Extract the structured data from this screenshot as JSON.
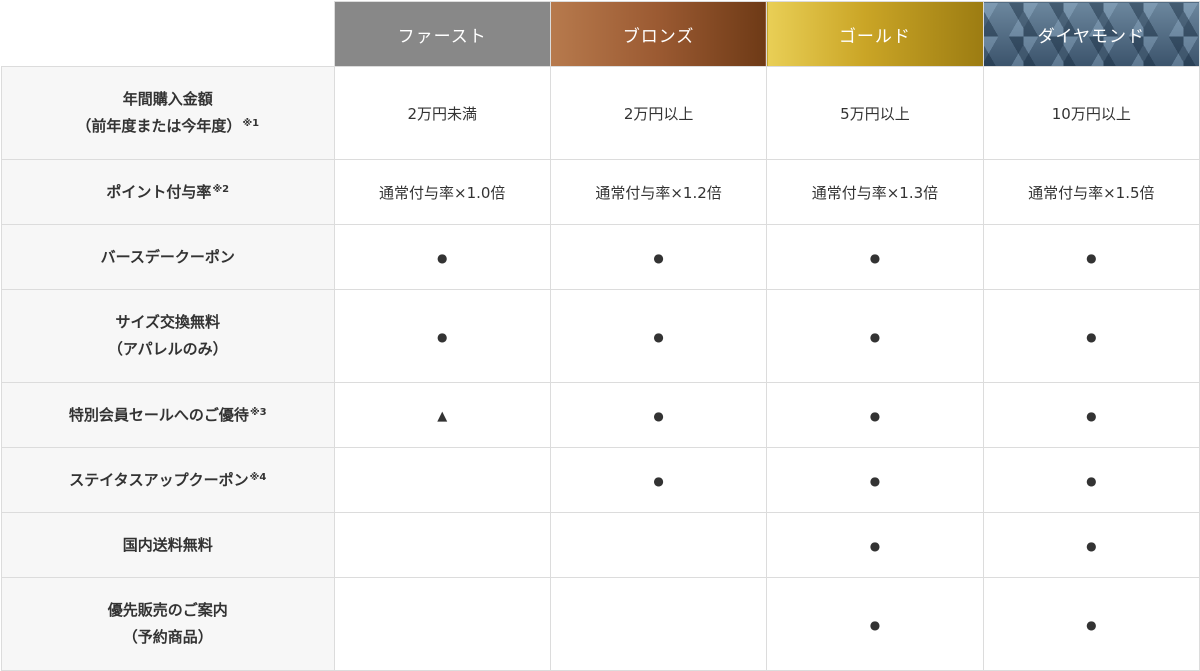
{
  "tiers": [
    {
      "name": "ファースト"
    },
    {
      "name": "ブロンズ"
    },
    {
      "name": "ゴールド"
    },
    {
      "name": "ダイヤモンド"
    }
  ],
  "rows": [
    {
      "label_lines": [
        "年間購入金額",
        "（前年度または今年度）"
      ],
      "note": "※1",
      "cells": [
        "2万円未満",
        "2万円以上",
        "5万円以上",
        "10万円以上"
      ]
    },
    {
      "label_lines": [
        "ポイント付与率"
      ],
      "note": "※2",
      "cells": [
        "通常付与率×1.0倍",
        "通常付与率×1.2倍",
        "通常付与率×1.3倍",
        "通常付与率×1.5倍"
      ]
    },
    {
      "label_lines": [
        "バースデークーポン"
      ],
      "note": "",
      "cells": [
        "●",
        "●",
        "●",
        "●"
      ]
    },
    {
      "label_lines": [
        "サイズ交換無料",
        "（アパレルのみ）"
      ],
      "note": "",
      "cells": [
        "●",
        "●",
        "●",
        "●"
      ]
    },
    {
      "label_lines": [
        "特別会員セールへのご優待"
      ],
      "note": "※3",
      "cells": [
        "▲",
        "●",
        "●",
        "●"
      ]
    },
    {
      "label_lines": [
        "ステイタスアップクーポン"
      ],
      "note": "※4",
      "cells": [
        "",
        "●",
        "●",
        "●"
      ]
    },
    {
      "label_lines": [
        "国内送料無料"
      ],
      "note": "",
      "cells": [
        "",
        "",
        "●",
        "●"
      ]
    },
    {
      "label_lines": [
        "優先販売のご案内",
        "（予約商品）"
      ],
      "note": "",
      "cells": [
        "",
        "",
        "●",
        "●"
      ]
    }
  ]
}
